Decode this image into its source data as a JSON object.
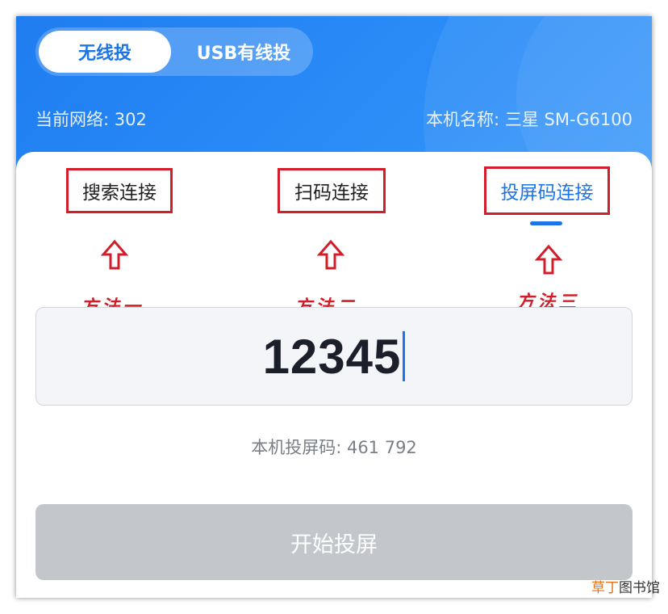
{
  "mode_toggle": {
    "wireless_label": "无线投",
    "usb_label": "USB有线投"
  },
  "network_info": {
    "current_network": "当前网络: 302",
    "device_name": "本机名称: 三星 SM-G6100"
  },
  "connect_methods": [
    {
      "label": "搜索连接",
      "annotation": "方法一",
      "active": false
    },
    {
      "label": "扫码连接",
      "annotation": "方法二",
      "active": false
    },
    {
      "label": "投屏码连接",
      "annotation": "方法三",
      "active": true
    }
  ],
  "code_input": {
    "value": "12345"
  },
  "local_cast_code": "本机投屏码: 461 792",
  "start_button_label": "开始投屏",
  "watermark": {
    "brand": "草丁",
    "rest": "图书馆"
  },
  "colors": {
    "primary_blue": "#1c74e6",
    "header_gradient_start": "#1f7df0",
    "annotation_red": "#d21e2a",
    "button_disabled": "#c3c7cc",
    "input_bg": "#f3f5f8"
  }
}
